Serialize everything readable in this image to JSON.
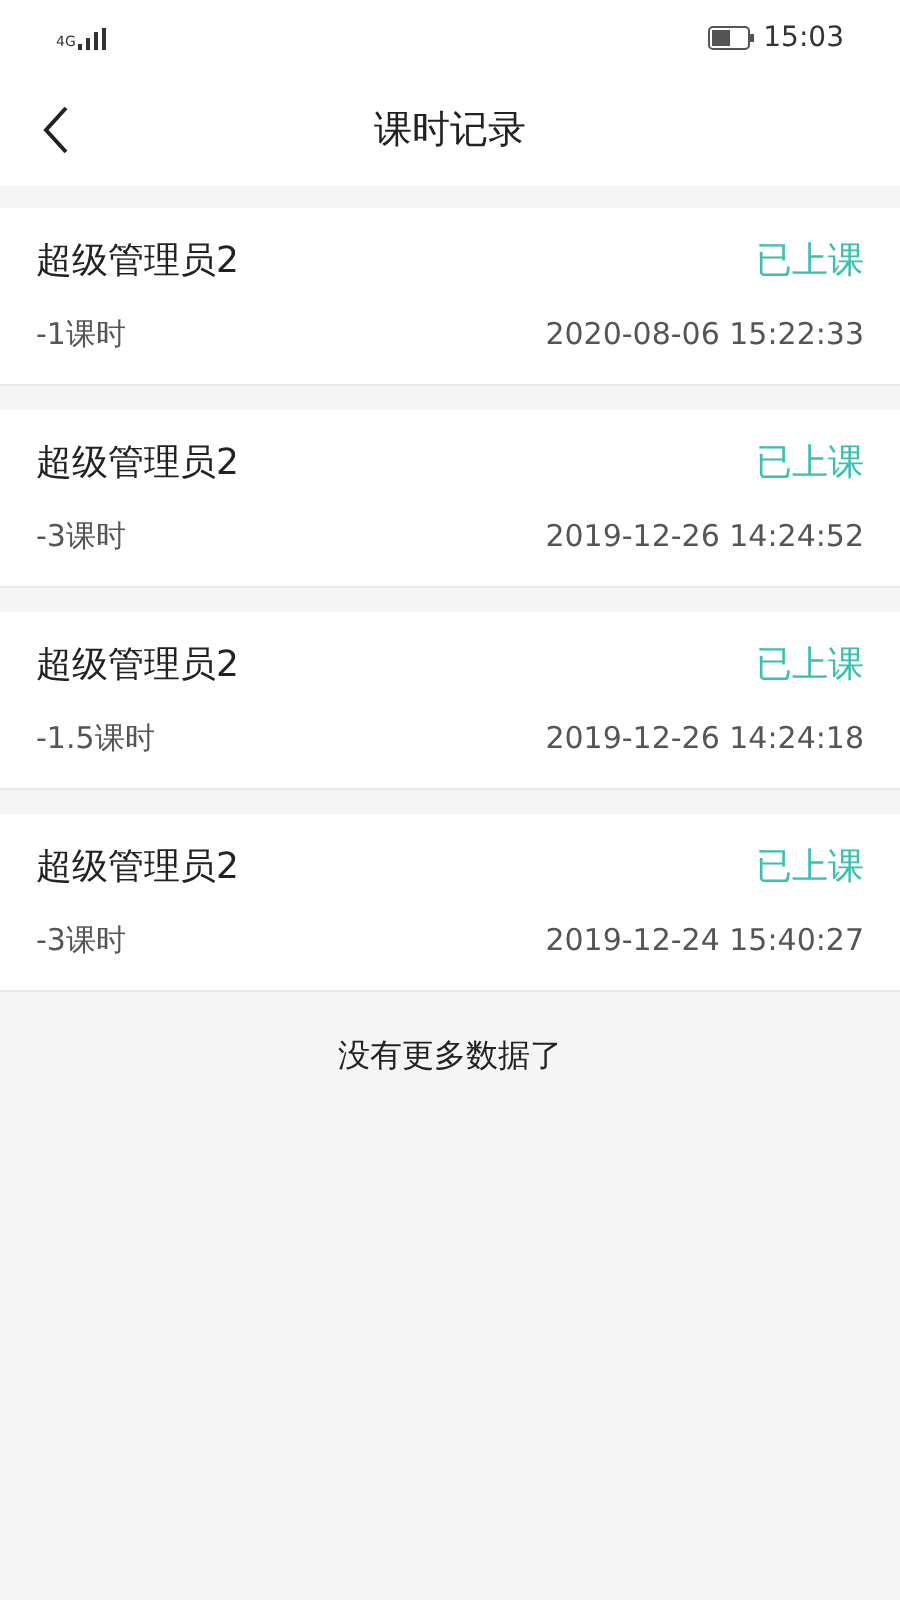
{
  "status_bar": {
    "network": "4G",
    "time": "15:03"
  },
  "header": {
    "title": "课时记录"
  },
  "records": [
    {
      "name": "超级管理员2",
      "status": "已上课",
      "hours": "-1课时",
      "time": "2020-08-06 15:22:33"
    },
    {
      "name": "超级管理员2",
      "status": "已上课",
      "hours": "-3课时",
      "time": "2019-12-26 14:24:52"
    },
    {
      "name": "超级管理员2",
      "status": "已上课",
      "hours": "-1.5课时",
      "time": "2019-12-26 14:24:18"
    },
    {
      "name": "超级管理员2",
      "status": "已上课",
      "hours": "-3课时",
      "time": "2019-12-24 15:40:27"
    }
  ],
  "footer": "没有更多数据了"
}
